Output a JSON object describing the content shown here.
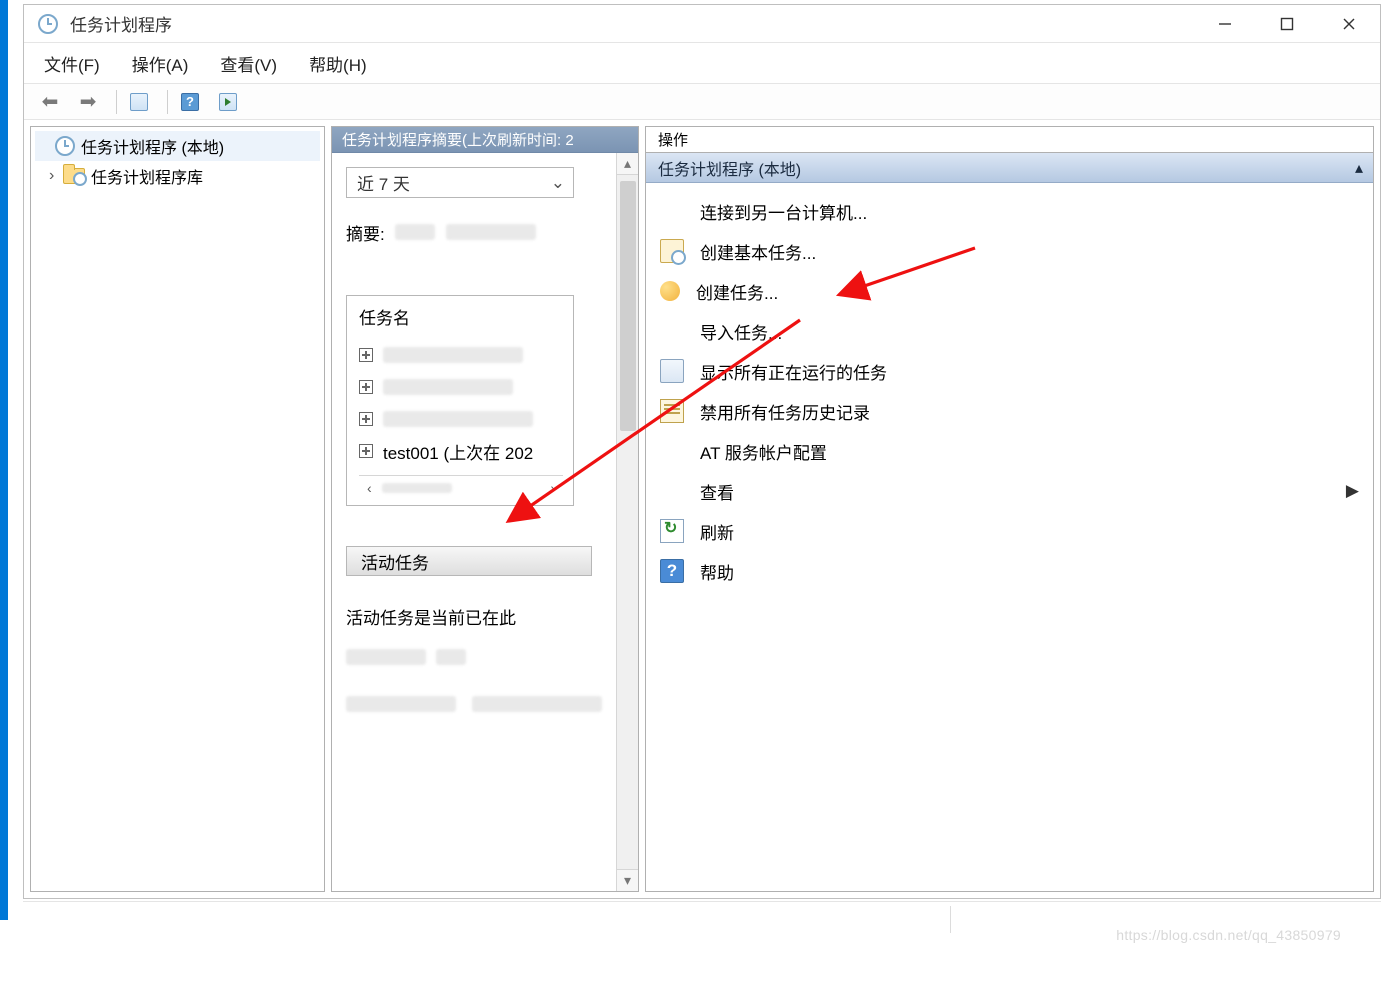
{
  "window": {
    "title": "任务计划程序"
  },
  "menu": {
    "file": "文件(F)",
    "action": "操作(A)",
    "view": "查看(V)",
    "help": "帮助(H)"
  },
  "tree": {
    "root": "任务计划程序 (本地)",
    "library": "任务计划程序库"
  },
  "middle": {
    "header": "任务计划程序摘要(上次刷新时间: 2",
    "range_option": "近 7 天",
    "summary_label": "摘要:",
    "task_header": "任务名",
    "task_test": "test001 (上次在 202",
    "active_header": "活动任务",
    "active_note": "活动任务是当前已在此"
  },
  "right": {
    "title": "操作",
    "subtitle": "任务计划程序 (本地)",
    "items": {
      "connect": "连接到另一台计算机...",
      "create_basic": "创建基本任务...",
      "create_task": "创建任务...",
      "import": "导入任务...",
      "show_running": "显示所有正在运行的任务",
      "disable_history": "禁用所有任务历史记录",
      "at_account": "AT 服务帐户配置",
      "view": "查看",
      "refresh": "刷新",
      "help": "帮助"
    }
  },
  "watermark": "https://blog.csdn.net/qq_43850979"
}
